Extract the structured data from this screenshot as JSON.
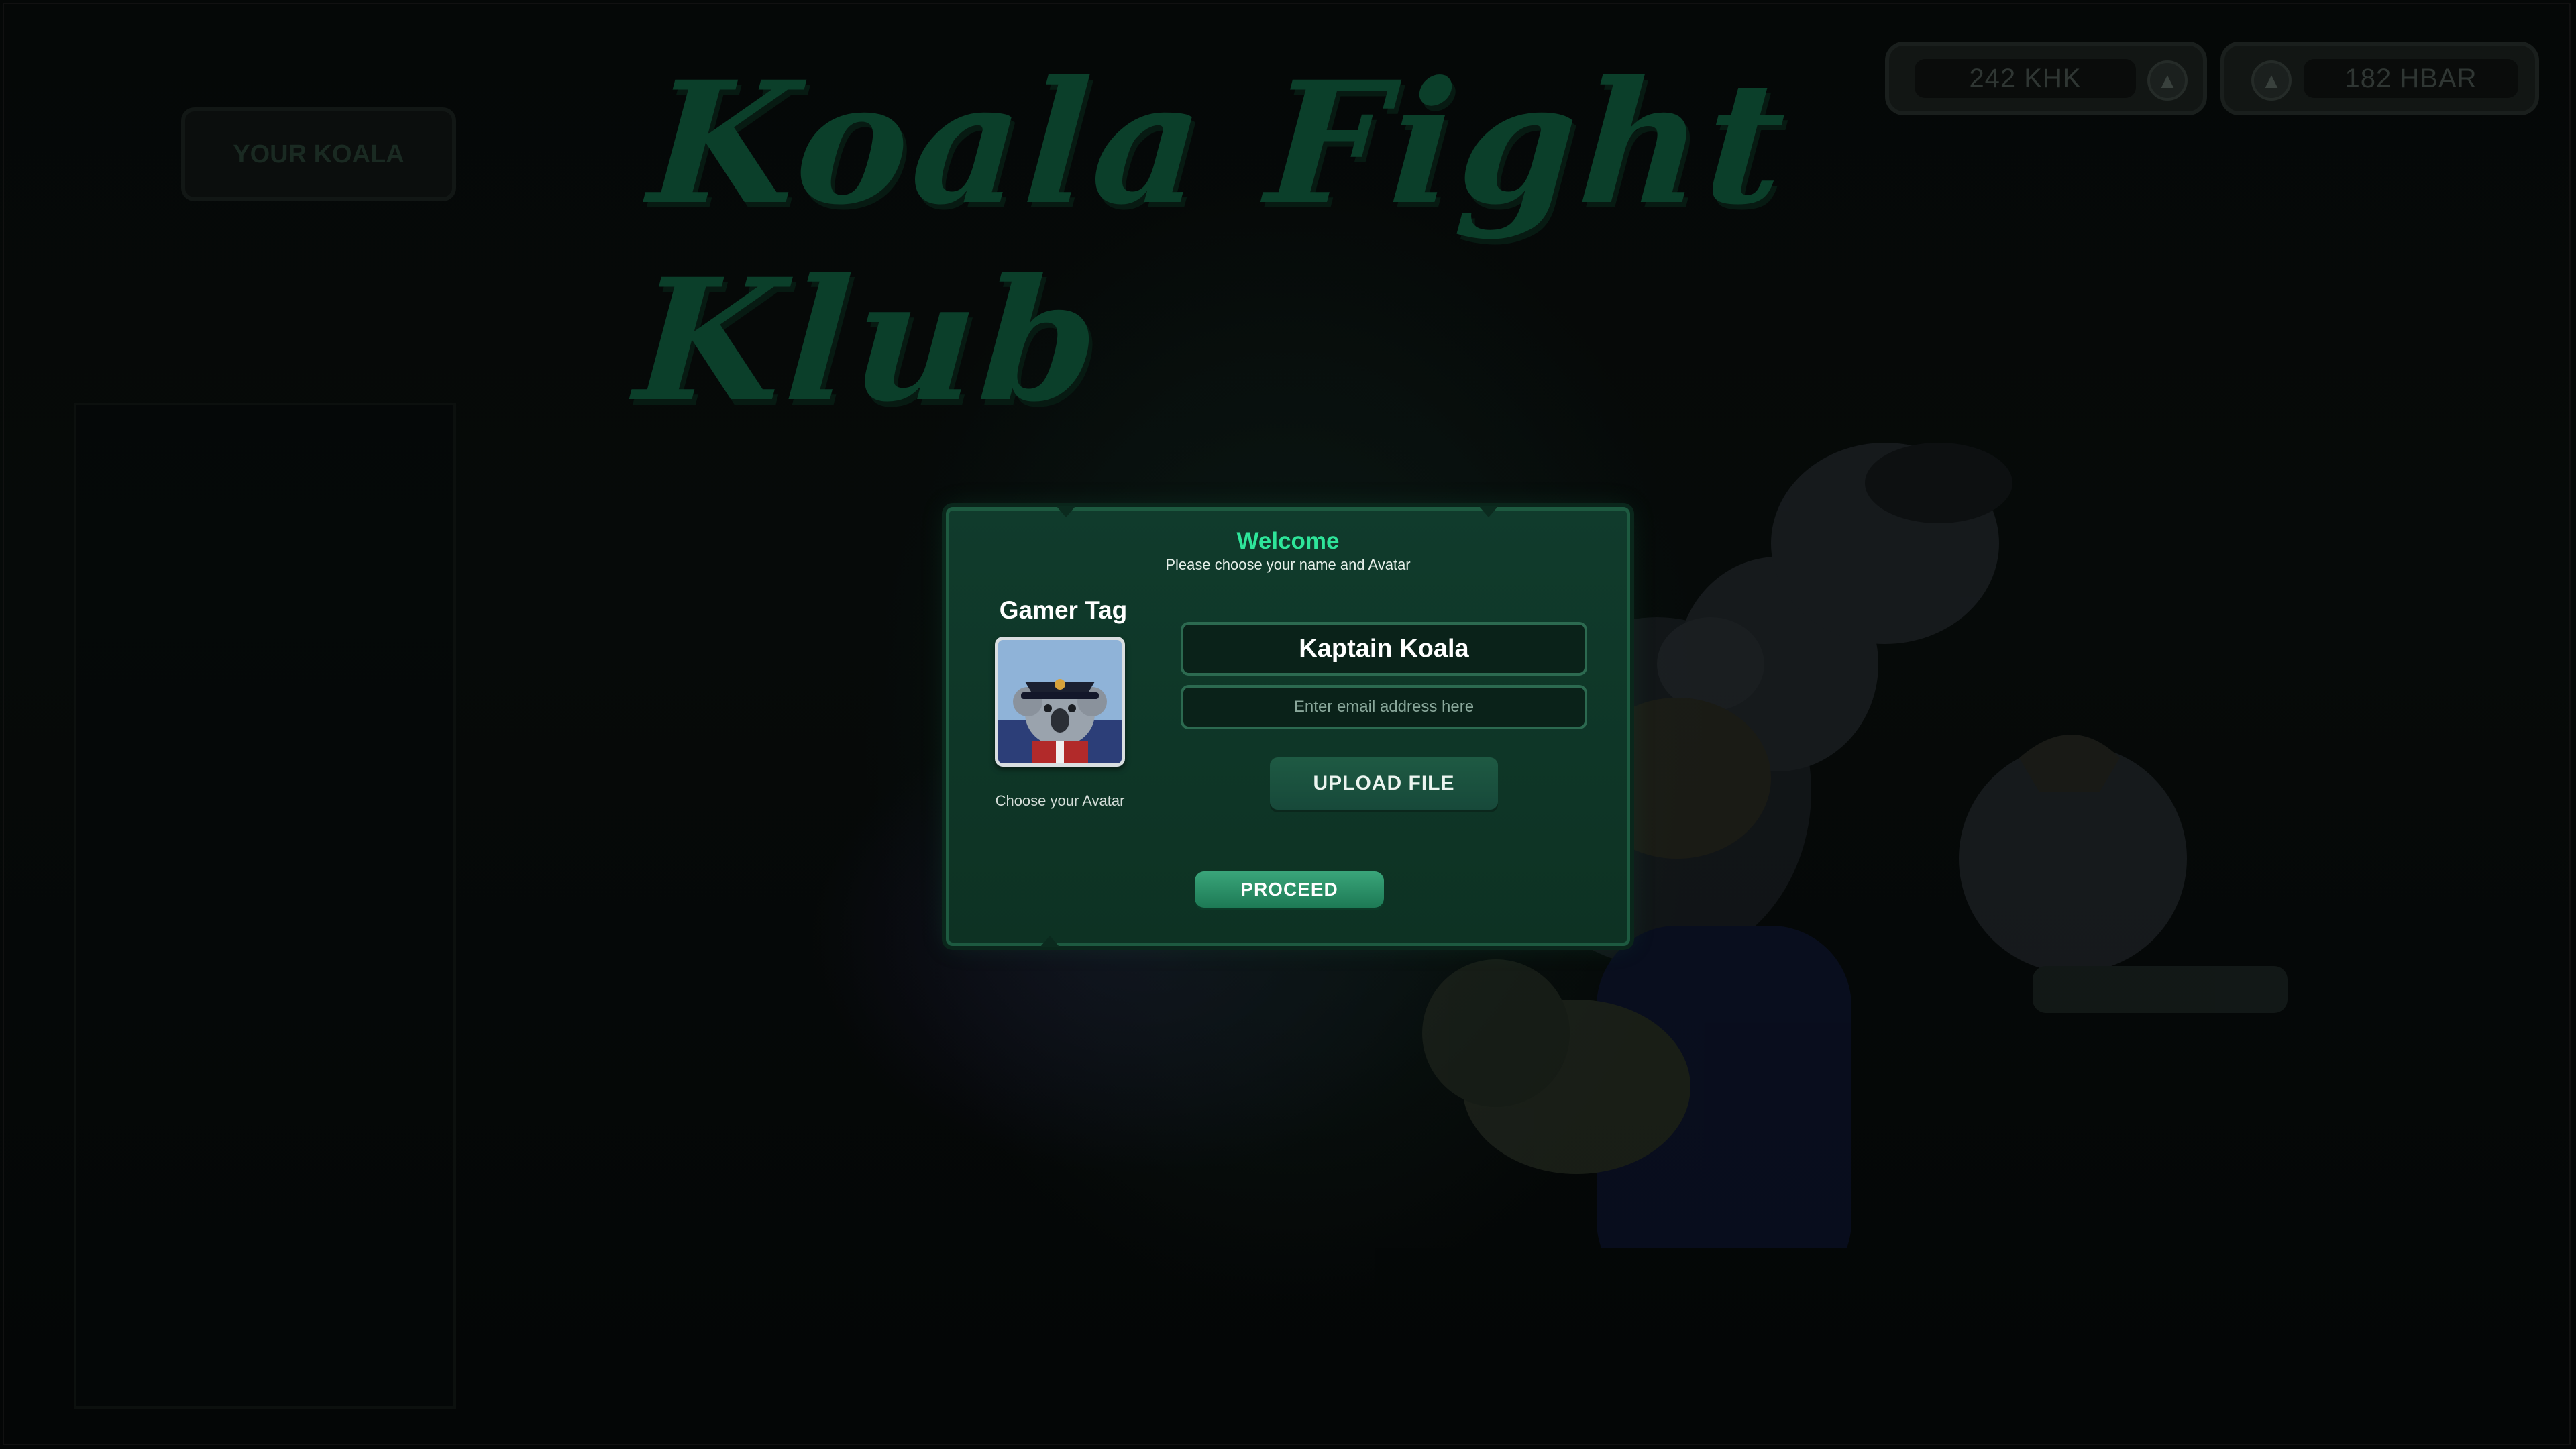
{
  "game": {
    "title": "Koala Fight Klub"
  },
  "side_panel": {
    "tab_label": "YOUR KOALA"
  },
  "currency": {
    "khk": {
      "value": "242 KHK",
      "icon": "hbar-coin-icon"
    },
    "hbar": {
      "value": "182 HBAR",
      "icon": "hbar-coin-icon"
    }
  },
  "dialog": {
    "welcome": "Welcome",
    "subtitle": "Please choose your name and Avatar",
    "gamer_tag_label": "Gamer Tag",
    "choose_avatar_label": "Choose your Avatar",
    "name_value": "Kaptain Koala",
    "email_placeholder": "Enter email address here",
    "upload_label": "UPLOAD FILE",
    "proceed_label": "PROCEED"
  },
  "colors": {
    "accent_green": "#2ee59a",
    "dialog_bg": "#103b2c",
    "dialog_border": "#1d5a40",
    "button_green": "#2a9068"
  }
}
